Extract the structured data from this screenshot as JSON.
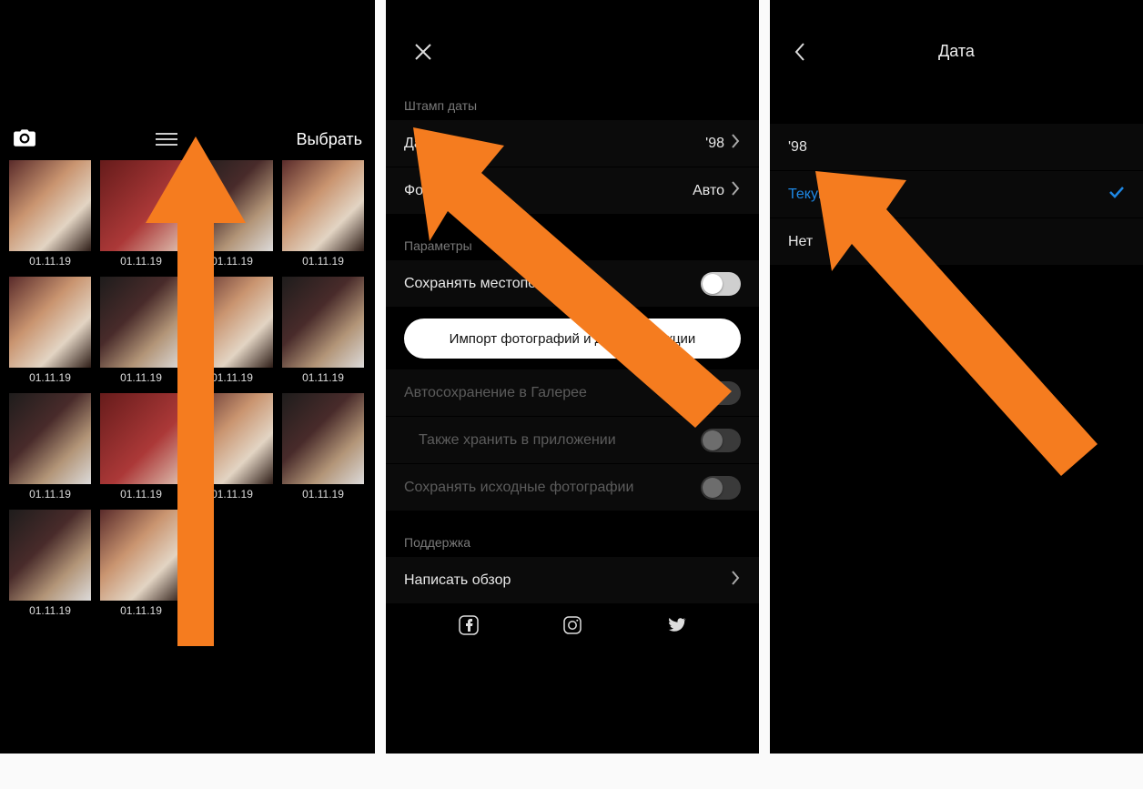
{
  "screen1": {
    "select_label": "Выбрать",
    "thumb_date": "01.11.19",
    "thumb_count": 14
  },
  "screen2": {
    "section_stamp": "Штамп даты",
    "row_date_label": "Дата",
    "row_date_value": "'98",
    "row_format_label": "Формат",
    "row_format_value": "Авто",
    "section_params": "Параметры",
    "row_save_location": "Сохранять местоположение",
    "import_button": "Импорт фотографий и другие функции",
    "row_autosave": "Автосохранение в Галерее",
    "row_keep_in_app": "Также хранить в приложении",
    "row_save_originals": "Сохранять исходные фотографии",
    "section_support": "Поддержка",
    "row_review": "Написать обзор"
  },
  "screen3": {
    "title": "Дата",
    "opt_98": "'98",
    "opt_current": "Текущая",
    "opt_none": "Нет"
  }
}
